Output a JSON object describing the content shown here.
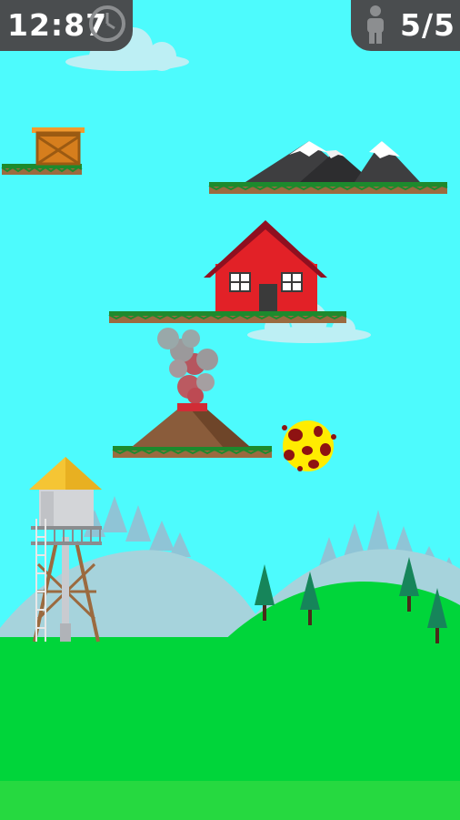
{
  "hud": {
    "timer_text": "12:87",
    "lives_text": "5/5"
  },
  "icons": {
    "timer": "clock-icon",
    "lives": "person-icon"
  },
  "colors": {
    "sky": "#4dfbfd",
    "grass": "#00d53a",
    "hills": "#a6d3dc",
    "house": "#e22127",
    "roof": "#8f1020",
    "hud_bg": "#4a4d4f"
  }
}
